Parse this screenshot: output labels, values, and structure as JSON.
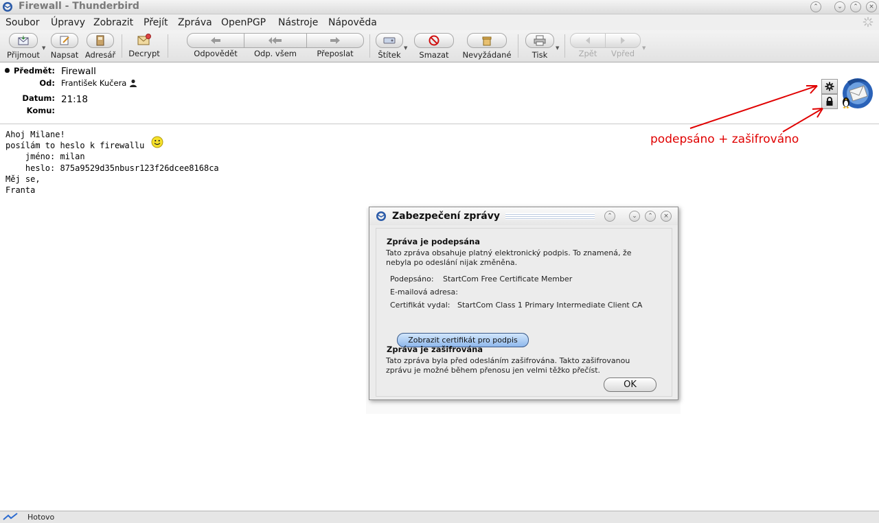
{
  "window": {
    "title": "Firewall - Thunderbird"
  },
  "menu": {
    "items": [
      {
        "label": "Soubor"
      },
      {
        "label": "Úpravy"
      },
      {
        "label": "Zobrazit"
      },
      {
        "label": "Přejít"
      },
      {
        "label": "Zpráva"
      },
      {
        "label": "OpenPGP"
      },
      {
        "label": "Nástroje"
      },
      {
        "label": "Nápověda"
      }
    ]
  },
  "toolbar": {
    "get_mail": "Přijmout",
    "write": "Napsat",
    "address_book": "Adresář",
    "decrypt": "Decrypt",
    "reply": "Odpovědět",
    "reply_all": "Odp. všem",
    "forward": "Přeposlat",
    "tag": "Štítek",
    "delete": "Smazat",
    "junk": "Nevyžádané",
    "print": "Tisk",
    "back": "Zpět",
    "forward_nav": "Vpřed"
  },
  "header": {
    "subject_label": "Předmět:",
    "subject": "Firewall",
    "from_label": "Od:",
    "from": "František Kučera",
    "date_label": "Datum:",
    "date": "21:18",
    "to_label": "Komu:",
    "to": ""
  },
  "body": {
    "lines": [
      "Ahoj Milane!",
      "",
      "posílám to heslo k firewallu",
      "    jméno: milan",
      "    heslo: 875a9529d35nbusr123f26dcee8168ca",
      "",
      "Měj se,",
      "Franta"
    ]
  },
  "annotation": {
    "text": "podepsáno + zašifrováno",
    "color": "#e00000"
  },
  "dialog": {
    "title": "Zabezpečení zprávy",
    "signed_heading": "Zpráva je podepsána",
    "signed_text_1": "Tato zpráva obsahuje platný elektronický podpis. To znamená, že",
    "signed_text_2": "nebyla po odeslání nijak změněna.",
    "signed_by_label": "Podepsáno:",
    "signed_by": "StartCom Free Certificate Member",
    "email_label": "E-mailová adresa:",
    "email": "",
    "issuer_label": "Certifikát vydal:",
    "issuer": "StartCom Class 1 Primary Intermediate Client CA",
    "view_cert_button": "Zobrazit certifikát pro podpis",
    "encrypted_heading": "Zpráva je zašifrována",
    "encrypted_text_1": "Tato zpráva byla před odesláním zašifrována. Takto zašifrovanou",
    "encrypted_text_2": "zprávu je možné během přenosu jen velmi těžko přečíst.",
    "ok_button": "OK"
  },
  "statusbar": {
    "text": "Hotovo"
  }
}
